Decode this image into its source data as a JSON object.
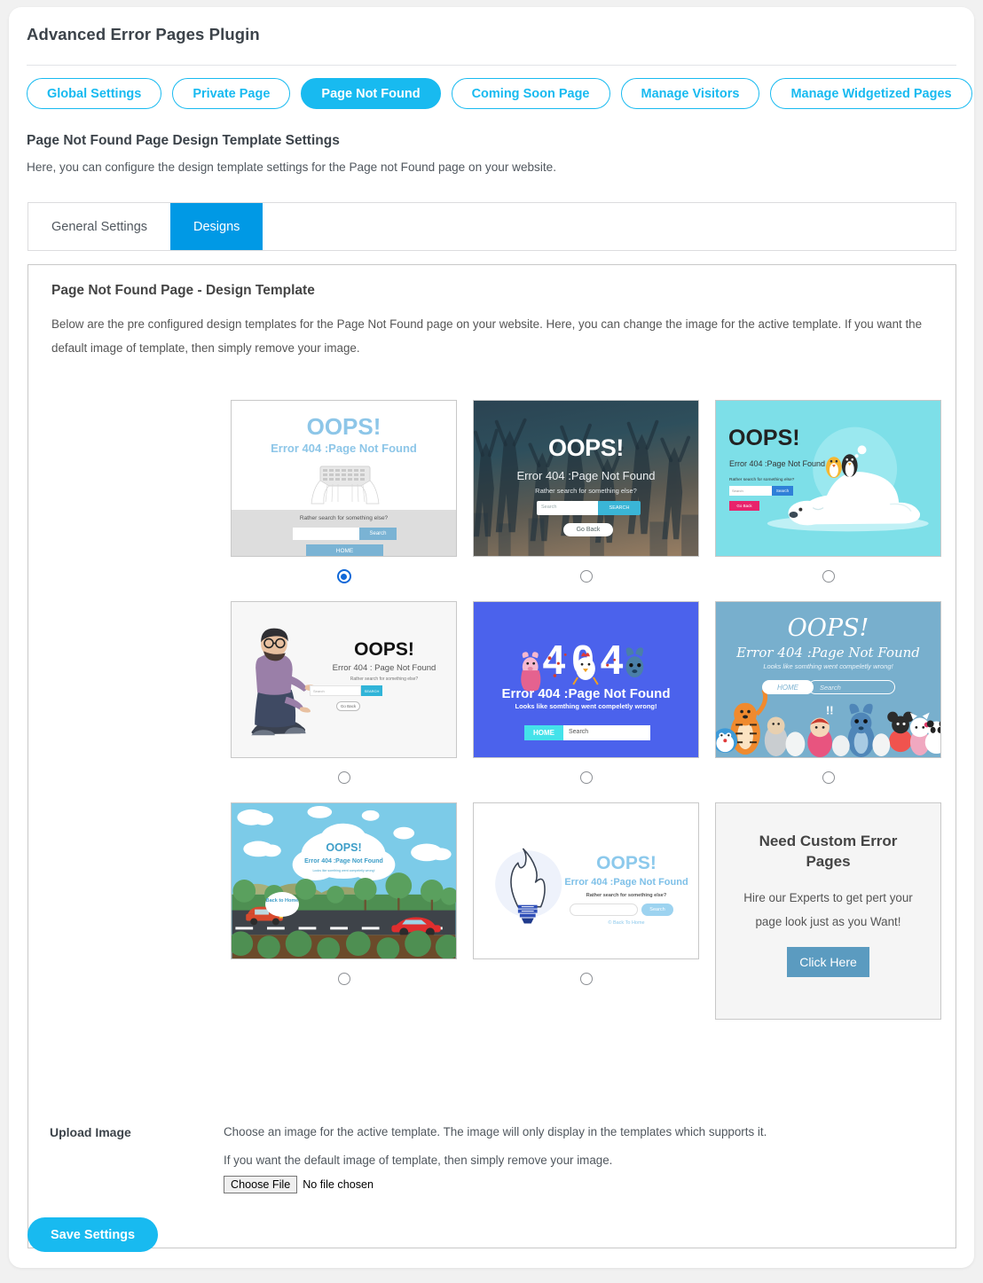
{
  "header": {
    "title": "Advanced Error Pages Plugin"
  },
  "top_tabs": [
    {
      "label": "Global Settings",
      "active": false
    },
    {
      "label": "Private Page",
      "active": false
    },
    {
      "label": "Page Not Found",
      "active": true
    },
    {
      "label": "Coming Soon Page",
      "active": false
    },
    {
      "label": "Manage Visitors",
      "active": false
    },
    {
      "label": "Manage Widgetized Pages",
      "active": false
    }
  ],
  "section": {
    "heading": "Page Not Found Page Design Template Settings",
    "subheading": "Here, you can configure the design template settings for the Page not Found page on your website."
  },
  "sub_tabs": [
    {
      "label": "General Settings",
      "active": false
    },
    {
      "label": "Designs",
      "active": true
    }
  ],
  "panel": {
    "title": "Page Not Found Page - Design Template",
    "description": "Below are the pre configured design templates for the Page Not Found page on your website. Here, you can change the image for the active template. If you want the default image of template, then simply remove your image."
  },
  "templates": [
    {
      "id": "template-1",
      "selected": true,
      "oops": "OOPS!",
      "error": "Error 404 :Page Not Found",
      "prompt": "Rather search for something else?",
      "search_button": "Search",
      "home_button": "HOME"
    },
    {
      "id": "template-2",
      "selected": false,
      "oops": "OOPS!",
      "error": "Error 404 :Page Not Found",
      "prompt": "Rather search for something else?",
      "search_placeholder": "Search",
      "search_button": "SEARCH",
      "back_button": "Go Back"
    },
    {
      "id": "template-3",
      "selected": false,
      "oops": "OOPS!",
      "error": "Error 404 :Page Not Found",
      "prompt": "Rather search for something else?",
      "search_placeholder": "Search",
      "search_button": "Search",
      "back_button": "Go Back"
    },
    {
      "id": "template-4",
      "selected": false,
      "oops": "OOPS!",
      "error": "Error 404 : Page Not Found",
      "prompt": "Rather search for something else?",
      "search_placeholder": "Search",
      "search_button": "SEARCH",
      "back_button": "Go Back"
    },
    {
      "id": "template-5",
      "selected": false,
      "code": "404",
      "error": "Error 404 :Page Not Found",
      "prompt": "Looks like somthing went compeletly wrong!",
      "home_button": "HOME",
      "search_placeholder": "Search"
    },
    {
      "id": "template-6",
      "selected": false,
      "oops": "OOPS!",
      "error": "Error 404 :Page Not Found",
      "prompt": "Looks like somthing went compeletly wrong!",
      "home_button": "HOME",
      "search_placeholder": "Search"
    },
    {
      "id": "template-7",
      "selected": false,
      "oops": "OOPS!",
      "error": "Error 404 :Page Not Found",
      "prompt": "Looks like somthing went compeletly wrong!",
      "back_button": "Back to Home"
    },
    {
      "id": "template-8",
      "selected": false,
      "oops": "OOPS!",
      "error": "Error 404 :Page Not Found",
      "prompt": "Rather search for something else?",
      "search_button": "Search",
      "back_link": "© Back To Home"
    }
  ],
  "promo": {
    "title": "Need Custom Error Pages",
    "text": "Hire our Experts to get pert your page look just as you Want!",
    "button": "Click Here"
  },
  "upload": {
    "label": "Upload Image",
    "line1": "Choose an image for the active template. The image will only display in the templates which supports it.",
    "line2": "If you want the default image of template, then simply remove your image.",
    "file_button": "Choose File",
    "file_status": "No file chosen"
  },
  "save_button": "Save Settings",
  "colors": {
    "accent": "#18baf0",
    "subtab_active": "#0099e5",
    "promo_button": "#5b9bc0",
    "radio_checked": "#1068d8"
  }
}
